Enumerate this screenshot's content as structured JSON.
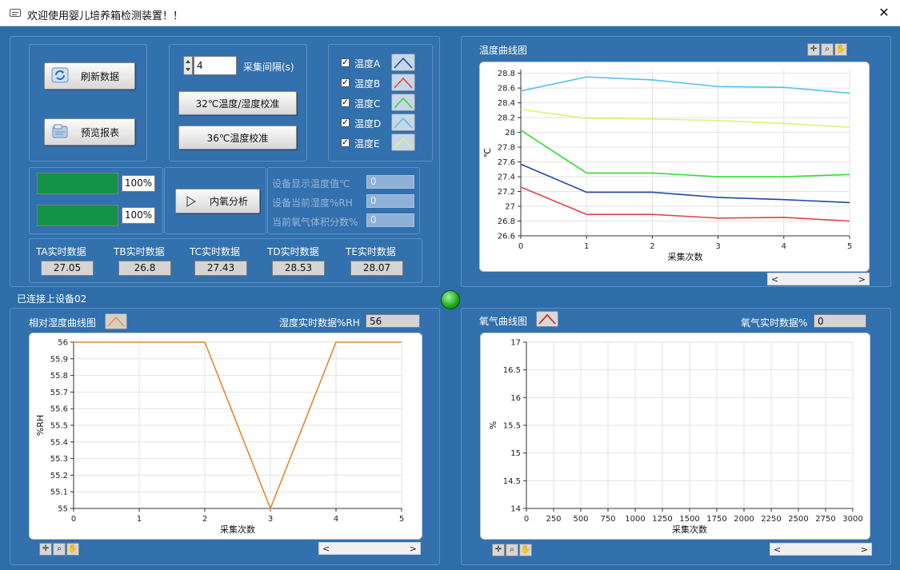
{
  "window": {
    "title": "欢迎使用婴儿培养箱检测装置！！",
    "close_glyph": "✕"
  },
  "buttons": {
    "refresh": "刷新数据",
    "preview": "预览报表",
    "calib32": "32℃温度/湿度校准",
    "calib36": "36℃温度校准",
    "oxygen": "内氧分析"
  },
  "interval": {
    "value": "4",
    "label": "采集间隔(s)"
  },
  "temp_checks": [
    {
      "label": "温度A",
      "checked": true,
      "color": "#1f4aa5"
    },
    {
      "label": "温度B",
      "checked": true,
      "color": "#e04545"
    },
    {
      "label": "温度C",
      "checked": true,
      "color": "#33dd33"
    },
    {
      "label": "温度D",
      "checked": true,
      "color": "#55c0ee"
    },
    {
      "label": "温度E",
      "checked": true,
      "color": "#e0f07a"
    }
  ],
  "progress": [
    {
      "value": 1.0,
      "label": "100%"
    },
    {
      "value": 1.0,
      "label": "100%"
    }
  ],
  "device_fields": [
    {
      "label": "设备显示温度值℃",
      "value": "0"
    },
    {
      "label": "设备当前湿度%RH",
      "value": "0"
    },
    {
      "label": "当前氧气体积分数%",
      "value": "0"
    }
  ],
  "realtime": [
    {
      "label": "TA实时数据",
      "value": "27.05"
    },
    {
      "label": "TB实时数据",
      "value": "26.8"
    },
    {
      "label": "TC实时数据",
      "value": "27.43"
    },
    {
      "label": "TD实时数据",
      "value": "28.53"
    },
    {
      "label": "TE实时数据",
      "value": "28.07"
    }
  ],
  "status": {
    "text": "已连接上设备02",
    "led_color": "#1aa81a"
  },
  "humidity": {
    "title": "相对湿度曲线图",
    "rt_label": "湿度实时数据%RH",
    "rt_value": "56"
  },
  "oxygen_panel": {
    "title": "氧气曲线图",
    "rt_label": "氧气实时数据%",
    "rt_value": "0"
  },
  "temp_panel": {
    "title": "温度曲线图"
  },
  "palette_icons": [
    "crosshair-icon",
    "zoom-icon",
    "hand-icon"
  ],
  "chart_data": [
    {
      "type": "line",
      "xlabel": "采集次数",
      "ylabel": "℃",
      "x": [
        0,
        1,
        2,
        3,
        4,
        5
      ],
      "xticks": [
        0,
        1,
        2,
        3,
        4,
        5
      ],
      "yticks": [
        26.6,
        26.8,
        27,
        27.2,
        27.4,
        27.6,
        27.8,
        28,
        28.2,
        28.4,
        28.6,
        28.8
      ],
      "xlim": [
        0,
        5
      ],
      "ylim": [
        26.6,
        28.85
      ],
      "grid": true,
      "series": [
        {
          "name": "温度A",
          "color": "#1f4aa5",
          "values": [
            27.57,
            27.19,
            27.19,
            27.12,
            27.09,
            27.05
          ]
        },
        {
          "name": "温度B",
          "color": "#e04545",
          "values": [
            27.26,
            26.89,
            26.89,
            26.84,
            26.85,
            26.8
          ]
        },
        {
          "name": "温度C",
          "color": "#33dd33",
          "values": [
            28.03,
            27.45,
            27.45,
            27.4,
            27.4,
            27.43
          ]
        },
        {
          "name": "温度D",
          "color": "#55c0ee",
          "values": [
            28.56,
            28.75,
            28.71,
            28.62,
            28.61,
            28.53
          ]
        },
        {
          "name": "温度E",
          "color": "#e0f07a",
          "values": [
            28.31,
            28.19,
            28.18,
            28.16,
            28.12,
            28.07
          ]
        }
      ]
    },
    {
      "type": "line",
      "xlabel": "采集次数",
      "ylabel": "%RH",
      "x": [
        0,
        1,
        2,
        3,
        4,
        5
      ],
      "xticks": [
        0,
        1,
        2,
        3,
        4,
        5
      ],
      "yticks": [
        55,
        55.1,
        55.2,
        55.3,
        55.4,
        55.5,
        55.6,
        55.7,
        55.8,
        55.9,
        56
      ],
      "xlim": [
        0,
        5
      ],
      "ylim": [
        55,
        56
      ],
      "grid": true,
      "series": [
        {
          "color": "#e08a2a",
          "values": [
            56,
            56,
            56,
            55,
            56,
            56
          ]
        }
      ]
    },
    {
      "type": "line",
      "xlabel": "采集次数",
      "ylabel": "%",
      "x": [],
      "xticks": [
        0,
        250,
        500,
        750,
        1000,
        1250,
        1500,
        1750,
        2000,
        2250,
        2500,
        2750,
        3000
      ],
      "yticks": [
        14,
        14.5,
        15,
        15.5,
        16,
        16.5,
        17
      ],
      "xlim": [
        0,
        3000
      ],
      "ylim": [
        14,
        17
      ],
      "grid": true,
      "series": []
    }
  ]
}
